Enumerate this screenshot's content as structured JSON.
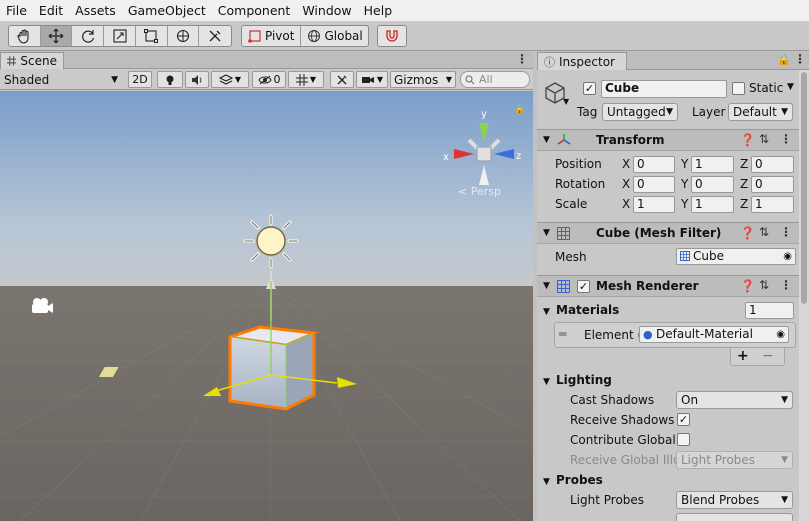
{
  "menu": [
    "File",
    "Edit",
    "Assets",
    "GameObject",
    "Component",
    "Window",
    "Help"
  ],
  "toolbar": {
    "pivot_label": "Pivot",
    "global_label": "Global"
  },
  "scene": {
    "tab_label": "Scene",
    "shading_mode": "Shaded",
    "mode_2d": "2D",
    "hidden_count": "0",
    "gizmos_label": "Gizmos",
    "search_placeholder": "All",
    "persp_label": "Persp",
    "axis_x": "x",
    "axis_y": "y",
    "axis_z": "z"
  },
  "inspector": {
    "tab_label": "Inspector",
    "object_name": "Cube",
    "static_label": "Static",
    "tag_label": "Tag",
    "tag_value": "Untagged",
    "layer_label": "Layer",
    "layer_value": "Default",
    "transform": {
      "title": "Transform",
      "position_label": "Position",
      "rotation_label": "Rotation",
      "scale_label": "Scale",
      "x_label": "X",
      "y_label": "Y",
      "z_label": "Z",
      "position": [
        "0",
        "1",
        "0"
      ],
      "rotation": [
        "0",
        "0",
        "0"
      ],
      "scale": [
        "1",
        "1",
        "1"
      ]
    },
    "mesh_filter": {
      "title": "Cube (Mesh Filter)",
      "mesh_label": "Mesh",
      "mesh_value": "Cube"
    },
    "mesh_renderer": {
      "title": "Mesh Renderer",
      "materials_label": "Materials",
      "materials_count": "1",
      "element_label": "Element (",
      "element_value": "Default-Material",
      "plus": "+",
      "minus": "−",
      "lighting_label": "Lighting",
      "cast_shadows_label": "Cast Shadows",
      "cast_shadows_value": "On",
      "receive_shadows_label": "Receive Shadows",
      "contribute_gi_label": "Contribute Global I",
      "receive_gi_label": "Receive Global Illu",
      "receive_gi_value": "Light Probes",
      "probes_label": "Probes",
      "light_probes_label": "Light Probes",
      "light_probes_value": "Blend Probes"
    }
  }
}
